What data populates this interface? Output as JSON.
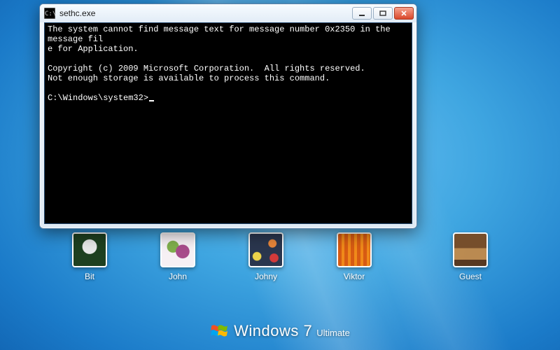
{
  "window": {
    "title": "sethc.exe",
    "icon_label": "C:\\"
  },
  "console": {
    "lines": [
      "The system cannot find message text for message number 0x2350 in the message fil",
      "e for Application.",
      "",
      "Copyright (c) 2009 Microsoft Corporation.  All rights reserved.",
      "Not enough storage is available to process this command.",
      ""
    ],
    "prompt": "C:\\Windows\\system32>"
  },
  "users": [
    {
      "name": "Bit"
    },
    {
      "name": "John"
    },
    {
      "name": "Johny"
    },
    {
      "name": "Viktor"
    },
    {
      "name": "Guest"
    }
  ],
  "branding": {
    "prefix": "Windows",
    "version": "7",
    "edition": "Ultimate"
  }
}
